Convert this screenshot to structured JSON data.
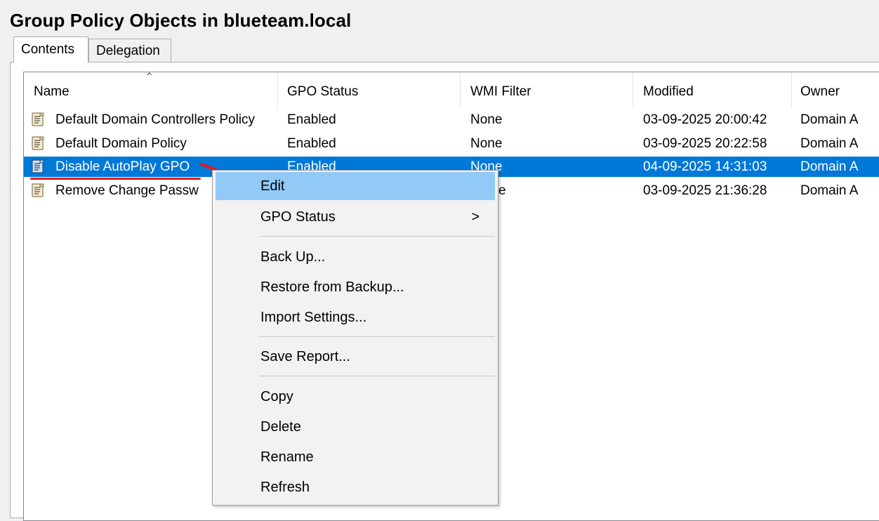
{
  "window": {
    "title": "Group Policy Objects in blueteam.local"
  },
  "tabs": [
    {
      "label": "Contents"
    },
    {
      "label": "Delegation"
    }
  ],
  "columns": [
    "Name",
    "GPO Status",
    "WMI Filter",
    "Modified",
    "Owner"
  ],
  "rows": [
    {
      "name": "Default Domain Controllers Policy",
      "status": "Enabled",
      "wmi": "None",
      "modified": "03-09-2025 20:00:42",
      "owner": "Domain A"
    },
    {
      "name": "Default Domain Policy",
      "status": "Enabled",
      "wmi": "None",
      "modified": "03-09-2025 20:22:58",
      "owner": "Domain A"
    },
    {
      "name": "Disable AutoPlay GPO",
      "status": "Enabled",
      "wmi": "None",
      "modified": "04-09-2025 14:31:03",
      "owner": "Domain A"
    },
    {
      "name": "Remove Change Passw",
      "status": "",
      "wmi": "e",
      "modified": "03-09-2025 21:36:28",
      "owner": "Domain A"
    }
  ],
  "selected_row": 2,
  "context_menu": {
    "items": [
      "Edit",
      "GPO Status",
      "Back Up...",
      "Restore from Backup...",
      "Import Settings...",
      "Save Report...",
      "Copy",
      "Delete",
      "Rename",
      "Refresh"
    ],
    "submenu_indicator": ">"
  },
  "colors": {
    "selection": "#0078d7",
    "menu_highlight": "#91c9f7",
    "annotation": "#e31b1b"
  },
  "icons": {
    "gpo_item": "gpo-scroll-icon",
    "sort": "sort-ascending-icon",
    "annotation": "red-arrow-annotation"
  }
}
